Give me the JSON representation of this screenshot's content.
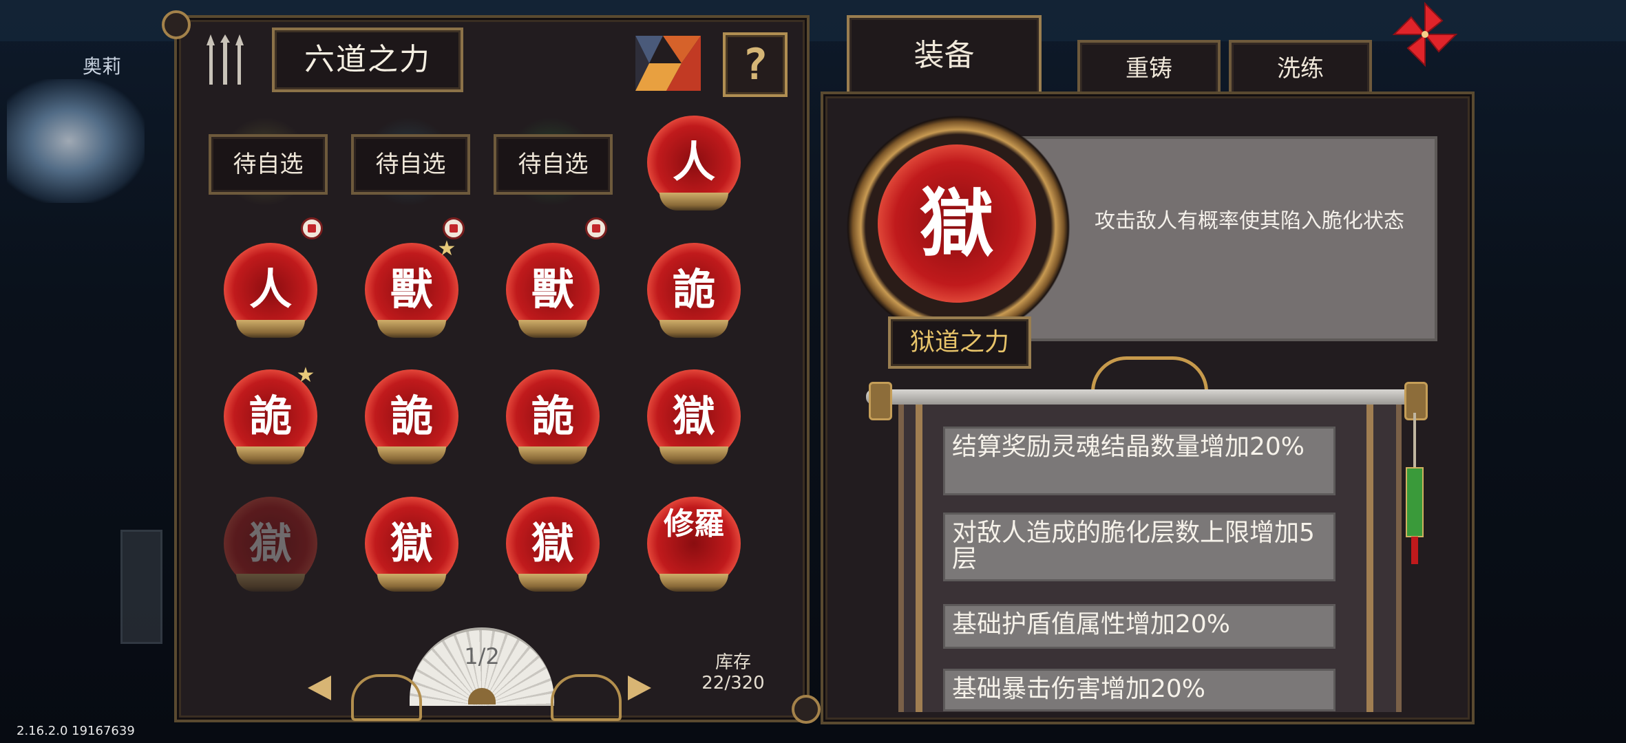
{
  "background": {
    "character_name": "奥莉",
    "version": "2.16.2.0 19167639"
  },
  "left": {
    "title": "六道之力",
    "icons": {
      "forks": "trident-icon",
      "puzzle": "tangram-icon",
      "help": "?"
    },
    "slots": [
      {
        "label": "待自选",
        "halo": "#6a6a3a"
      },
      {
        "label": "待自选",
        "halo": "#2e5a6a"
      },
      {
        "label": "待自选",
        "halo": "#2e6a3a"
      }
    ],
    "equipped_orb": "人",
    "grid": [
      {
        "glyph": "人",
        "starred": false,
        "dim": false
      },
      {
        "glyph": "獸",
        "starred": true,
        "dim": false
      },
      {
        "glyph": "獸",
        "starred": false,
        "dim": false
      },
      {
        "glyph": "詭",
        "starred": false,
        "dim": false
      },
      {
        "glyph": "詭",
        "starred": true,
        "dim": false
      },
      {
        "glyph": "詭",
        "starred": false,
        "dim": false
      },
      {
        "glyph": "詭",
        "starred": false,
        "dim": false
      },
      {
        "glyph": "獄",
        "starred": false,
        "dim": false
      },
      {
        "glyph": "獄",
        "starred": false,
        "dim": true
      },
      {
        "glyph": "獄",
        "starred": false,
        "dim": false
      },
      {
        "glyph": "獄",
        "starred": false,
        "dim": false
      },
      {
        "glyph": "修羅",
        "starred": false,
        "dim": false
      }
    ],
    "pager": "1/2",
    "stock_label": "库存",
    "stock_value": "22/320"
  },
  "right": {
    "tabs": {
      "equip": "装备",
      "recast": "重铸",
      "refine": "洗练"
    },
    "selected_glyph": "獄",
    "selected_name": "狱道之力",
    "description": "攻击敌人有概率使其陷入脆化状态",
    "attributes": [
      "结算奖励灵魂结晶数量增加20%",
      "对敌人造成的脆化层数上限增加5层",
      "基础护盾值属性增加20%",
      "基础暴击伤害增加20%"
    ]
  },
  "colors": {
    "orb_red": "#c01a1c",
    "gold_frame": "#9a7e50",
    "name_gold": "#e8c46a"
  }
}
